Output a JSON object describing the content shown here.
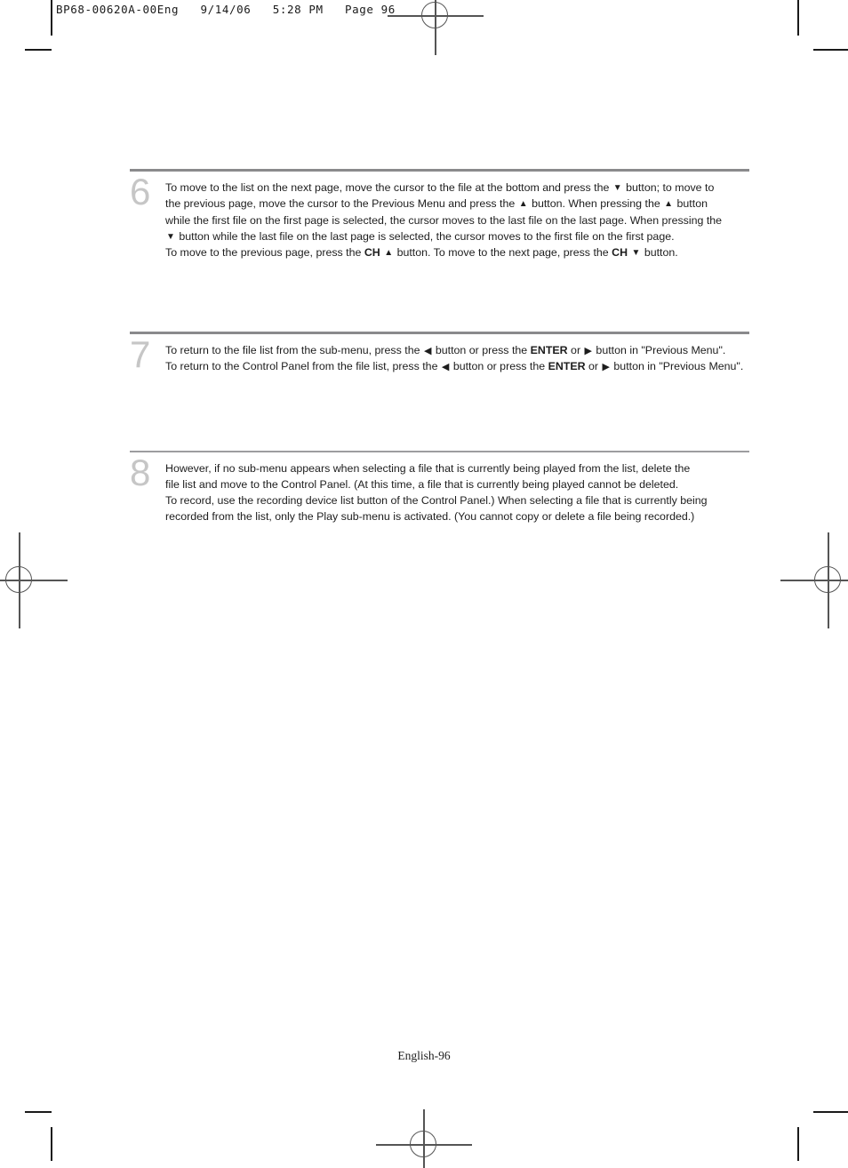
{
  "prepress": {
    "slug": "BP68-00620A-00Eng   9/14/06   5:28 PM   Page 96",
    "marks": {
      "registration_top": "registration-target",
      "registration_left": "registration-target",
      "registration_right": "registration-target",
      "registration_bottom": "registration-target"
    }
  },
  "page": {
    "footer": "English-96",
    "steps": [
      {
        "number": "6",
        "lines": [
          [
            {
              "t": "To move to the list on the next page, move the cursor to the file at the bottom and press the "
            },
            {
              "icon": "arrow-down-icon",
              "glyph": "▼"
            },
            {
              "t": " button; to move to"
            }
          ],
          [
            {
              "t": "the previous page, move the cursor to the Previous Menu and press the "
            },
            {
              "icon": "arrow-up-icon",
              "glyph": "▲"
            },
            {
              "t": " button. When pressing the "
            },
            {
              "icon": "arrow-up-icon",
              "glyph": "▲"
            },
            {
              "t": " button"
            }
          ],
          [
            {
              "t": "while the first file on the first page is selected, the cursor moves to the last file on the last page. When pressing the"
            }
          ],
          [
            {
              "icon": "arrow-down-icon",
              "glyph": "▼"
            },
            {
              "t": " button while the last file on the last page is selected, the cursor moves to the first file on the first page."
            }
          ],
          [
            {
              "t": "To move to the previous page, press the "
            },
            {
              "t": "CH",
              "b": true
            },
            {
              "t": " "
            },
            {
              "icon": "arrow-up-icon",
              "glyph": "▲"
            },
            {
              "t": " button. To move to the next page, press the "
            },
            {
              "t": "CH",
              "b": true
            },
            {
              "t": " "
            },
            {
              "icon": "arrow-down-icon",
              "glyph": "▼"
            },
            {
              "t": " button."
            }
          ]
        ]
      },
      {
        "number": "7",
        "lines": [
          [
            {
              "t": "To return to the file list from the sub-menu, press the "
            },
            {
              "icon": "arrow-left-icon",
              "glyph": "◀"
            },
            {
              "t": " button or press the "
            },
            {
              "t": "ENTER",
              "b": true
            },
            {
              "t": " or "
            },
            {
              "icon": "arrow-right-icon",
              "glyph": "▶"
            },
            {
              "t": " button in \"Previous Menu\"."
            }
          ],
          [
            {
              "t": "To return to the Control Panel from the file list, press the "
            },
            {
              "icon": "arrow-left-icon",
              "glyph": "◀"
            },
            {
              "t": " button or press the "
            },
            {
              "t": "ENTER",
              "b": true
            },
            {
              "t": " or "
            },
            {
              "icon": "arrow-right-icon",
              "glyph": "▶"
            },
            {
              "t": " button in \"Previous Menu\"."
            }
          ]
        ]
      },
      {
        "number": "8",
        "lines": [
          [
            {
              "t": "However, if no sub-menu appears when selecting a file that is currently being played from the list, delete the"
            }
          ],
          [
            {
              "t": "file list and move to the Control Panel. (At this time, a file that is currently being played cannot be deleted."
            }
          ],
          [
            {
              "t": "To record, use the recording device list button of the Control Panel.) When selecting a file that is currently being"
            }
          ],
          [
            {
              "t": "recorded from the list, only the Play sub-menu is activated. (You cannot copy or delete a file being recorded.)"
            }
          ]
        ]
      }
    ]
  },
  "colors": {
    "step_number": "#c6c6c6",
    "divider": "#8a8a8c",
    "text": "#1d1d1d"
  }
}
